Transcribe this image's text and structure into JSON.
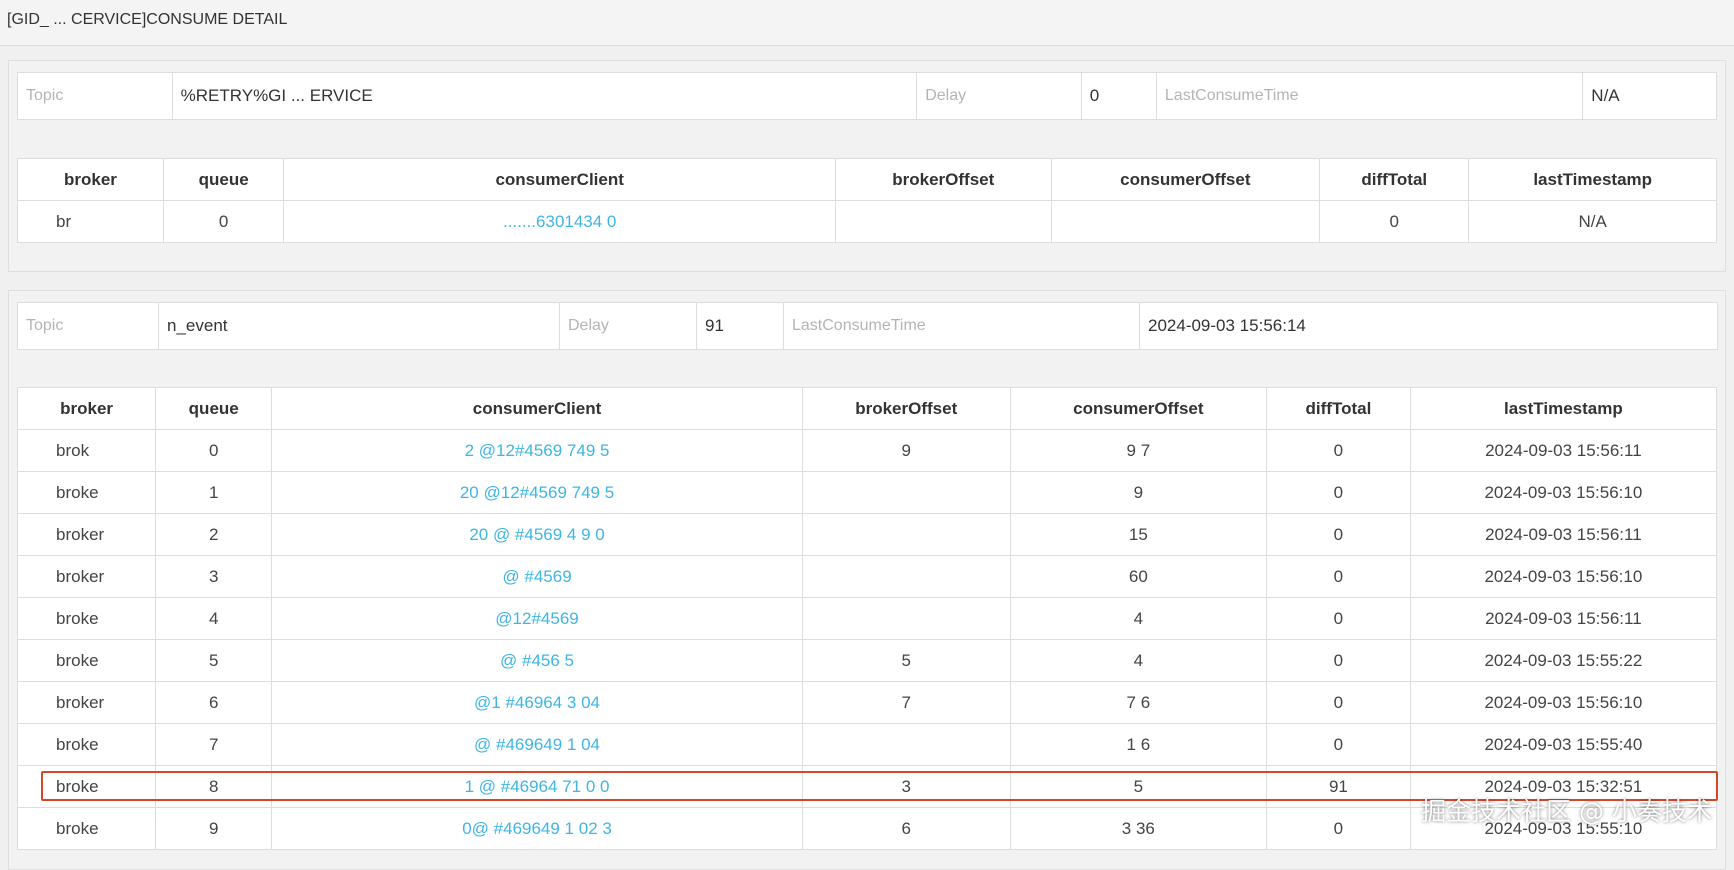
{
  "page": {
    "title": "[GID_ ... CERVICE]CONSUME DETAIL"
  },
  "colors": {
    "accent": "#3db6e6",
    "highlight": "#d7462b"
  },
  "watermark": "掘金技术社区 @ 小奏技术",
  "groups": [
    {
      "info": {
        "topic_label": "Topic",
        "topic_value": "%RETRY%GI ... ERVICE",
        "delay_label": "Delay",
        "delay_value": "0",
        "last_label": "LastConsumeTime",
        "last_value": "N/A"
      },
      "headers": [
        "broker",
        "queue",
        "consumerClient",
        "brokerOffset",
        "consumerOffset",
        "diffTotal",
        "lastTimestamp"
      ],
      "rows": [
        {
          "broker": "br",
          "queue": "0",
          "client": ".......6301434 0",
          "brokerOffset": "",
          "consumerOffset": "",
          "diffTotal": "0",
          "lastTimestamp": "N/A"
        }
      ]
    },
    {
      "info": {
        "topic_label": "Topic",
        "topic_value": "n_event",
        "delay_label": "Delay",
        "delay_value": "91",
        "last_label": "LastConsumeTime",
        "last_value": "2024-09-03 15:56:14"
      },
      "headers": [
        "broker",
        "queue",
        "consumerClient",
        "brokerOffset",
        "consumerOffset",
        "diffTotal",
        "lastTimestamp"
      ],
      "rows": [
        {
          "broker": "brok",
          "queue": "0",
          "client": "2 @12#4569 749 5",
          "brokerOffset": "9",
          "consumerOffset": "9 7",
          "diffTotal": "0",
          "lastTimestamp": "2024-09-03 15:56:11"
        },
        {
          "broker": "broke",
          "queue": "1",
          "client": "20 @12#4569 749 5",
          "brokerOffset": "",
          "consumerOffset": "9",
          "diffTotal": "0",
          "lastTimestamp": "2024-09-03 15:56:10"
        },
        {
          "broker": "broker",
          "queue": "2",
          "client": "20 @ #4569 4 9 0",
          "brokerOffset": "",
          "consumerOffset": "15",
          "diffTotal": "0",
          "lastTimestamp": "2024-09-03 15:56:11"
        },
        {
          "broker": "broker",
          "queue": "3",
          "client": "@ #4569",
          "brokerOffset": "",
          "consumerOffset": "60",
          "diffTotal": "0",
          "lastTimestamp": "2024-09-03 15:56:10"
        },
        {
          "broker": "broke",
          "queue": "4",
          "client": "@12#4569",
          "brokerOffset": "",
          "consumerOffset": "4",
          "diffTotal": "0",
          "lastTimestamp": "2024-09-03 15:56:11"
        },
        {
          "broker": "broke",
          "queue": "5",
          "client": "@ #456 5",
          "brokerOffset": "5",
          "consumerOffset": "4",
          "diffTotal": "0",
          "lastTimestamp": "2024-09-03 15:55:22"
        },
        {
          "broker": "broker",
          "queue": "6",
          "client": "@1 #46964 3 04",
          "brokerOffset": "7",
          "consumerOffset": "7 6",
          "diffTotal": "0",
          "lastTimestamp": "2024-09-03 15:56:10"
        },
        {
          "broker": "broke",
          "queue": "7",
          "client": "@ #469649 1 04",
          "brokerOffset": "",
          "consumerOffset": "1 6",
          "diffTotal": "0",
          "lastTimestamp": "2024-09-03 15:55:40"
        },
        {
          "broker": "broke",
          "queue": "8",
          "client": "1 @ #46964 71 0 0",
          "brokerOffset": "3",
          "consumerOffset": "5",
          "diffTotal": "91",
          "lastTimestamp": "2024-09-03 15:32:51"
        },
        {
          "broker": "broke",
          "queue": "9",
          "client": "0@ #469649 1 02 3",
          "brokerOffset": "6",
          "consumerOffset": "3 36",
          "diffTotal": "0",
          "lastTimestamp": "2024-09-03 15:55:10"
        }
      ]
    }
  ]
}
